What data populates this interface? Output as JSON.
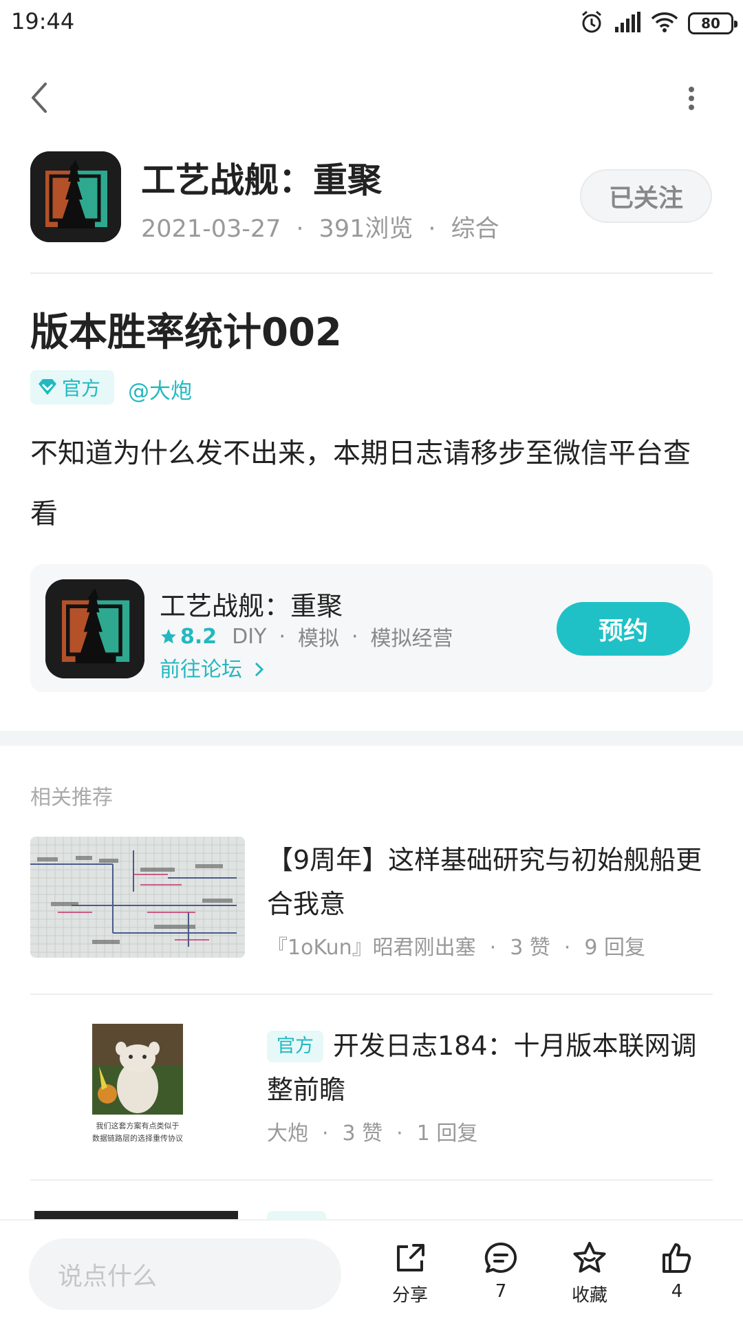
{
  "status_bar": {
    "time": "19:44",
    "battery": "80"
  },
  "header": {
    "title": "工艺战舰：重聚",
    "date": "2021-03-27",
    "views": "391浏览",
    "category": "综合",
    "follow_label": "已关注"
  },
  "post": {
    "title": "版本胜率统计002",
    "badge": "官方",
    "author": "@大炮",
    "body": "不知道为什么发不出来，本期日志请移步至微信平台查看"
  },
  "game_card": {
    "name": "工艺战舰：重聚",
    "rating": "8.2",
    "tags": [
      "DIY",
      "模拟",
      "模拟经营"
    ],
    "forum_link": "前往论坛",
    "reserve_label": "预约"
  },
  "related": {
    "header": "相关推荐",
    "items": [
      {
        "title": "【9周年】这样基础研究与初始舰船更合我意",
        "author": "『1oKun』昭君刚出塞",
        "likes": "3 赞",
        "replies": "9 回复"
      },
      {
        "badge": "官方",
        "title": "开发日志184：十月版本联网调整前瞻",
        "author": "大炮",
        "likes": "3 赞",
        "replies": "1 回复",
        "thumb_caption_1": "我们这套方案有点类似于",
        "thumb_caption_2": "数据链路层的选择重传协议"
      }
    ]
  },
  "bottom_bar": {
    "comment_placeholder": "说点什么",
    "share_label": "分享",
    "comment_count": "7",
    "favorite_label": "收藏",
    "like_count": "4"
  },
  "colors": {
    "accent": "#1fc1c6",
    "accent_text": "#23b8c0"
  }
}
